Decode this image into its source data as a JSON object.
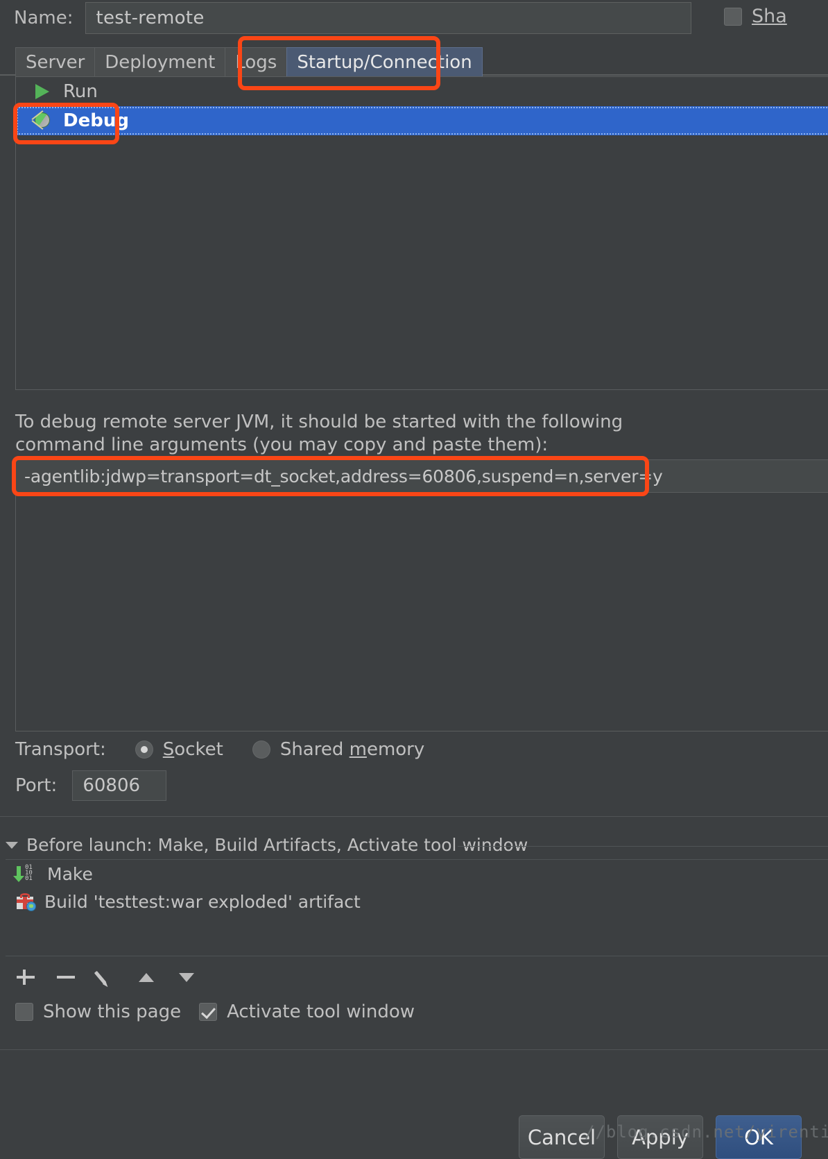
{
  "name_row": {
    "label": "Name:",
    "value": "test-remote",
    "share_label": "Sha",
    "share_checked": false
  },
  "tabs": [
    {
      "label": "Server",
      "active": false
    },
    {
      "label": "Deployment",
      "active": false
    },
    {
      "label": "Logs",
      "active": false
    },
    {
      "label": "Startup/Connection",
      "active": true
    }
  ],
  "run_list": [
    {
      "label": "Run",
      "icon": "play-icon",
      "selected": false
    },
    {
      "label": "Debug",
      "icon": "bug-icon",
      "selected": true
    }
  ],
  "description": {
    "line1": "To debug remote server JVM, it should be started with the following",
    "line2": "command line arguments (you may copy and paste them):"
  },
  "command_line": "-agentlib:jdwp=transport=dt_socket,address=60806,suspend=n,server=y",
  "transport": {
    "label": "Transport:",
    "options": [
      {
        "label_pre": "",
        "mnemonic": "S",
        "label_post": "ocket",
        "selected": true
      },
      {
        "label_pre": "Shared ",
        "mnemonic": "m",
        "label_post": "emory",
        "selected": false
      }
    ]
  },
  "port": {
    "label": "Port:",
    "value": "60806"
  },
  "before_launch": {
    "header": "Before launch: Make, Build Artifacts, Activate tool window",
    "items": [
      {
        "label": "Make",
        "icon": "make-icon"
      },
      {
        "label": "Build 'testtest:war exploded' artifact",
        "icon": "artifact-icon"
      }
    ],
    "toolbar": [
      {
        "name": "add-button",
        "icon": "plus-icon"
      },
      {
        "name": "remove-button",
        "icon": "minus-icon"
      },
      {
        "name": "edit-button",
        "icon": "pencil-icon"
      },
      {
        "name": "move-up-button",
        "icon": "arrow-up-icon"
      },
      {
        "name": "move-down-button",
        "icon": "arrow-down-icon"
      }
    ]
  },
  "bottom_options": {
    "show_this_page": {
      "label": "Show this page",
      "checked": false
    },
    "activate_tool_window": {
      "label": "Activate tool window",
      "checked": true
    }
  },
  "buttons": {
    "cancel": "Cancel",
    "apply": "Apply",
    "ok": "OK"
  },
  "watermark": "//blog.csdn.net/yirentianran",
  "colors": {
    "background": "#3c3f41",
    "selection": "#2f65ca",
    "tab_active": "#4b5a73",
    "annotation": "#fa4616",
    "primary_button": "#2f4e7e"
  }
}
